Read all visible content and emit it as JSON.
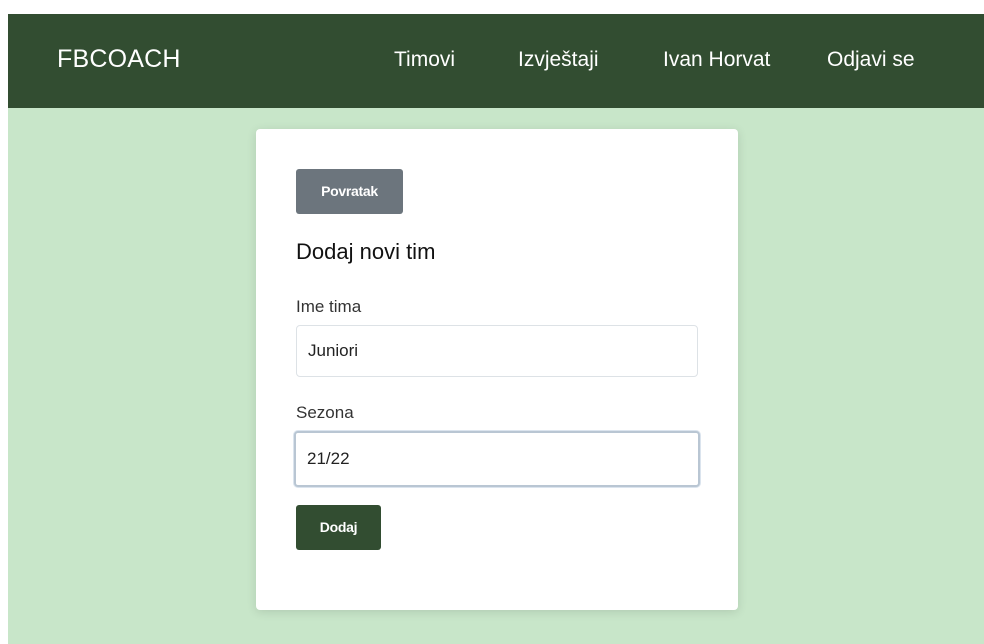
{
  "navbar": {
    "brand": "FBCOACH",
    "links": {
      "teams": "Timovi",
      "reports": "Izvještaji",
      "user": "Ivan Horvat",
      "logout": "Odjavi se"
    }
  },
  "form": {
    "back_label": "Povratak",
    "title": "Dodaj novi tim",
    "team_name_label": "Ime tima",
    "team_name_value": "Juniori",
    "season_label": "Sezona",
    "season_value": "21/22",
    "submit_label": "Dodaj"
  },
  "colors": {
    "navbar_bg": "#324d31",
    "page_bg": "#c8e6c9",
    "back_button": "#6c757d",
    "submit_button": "#324d31"
  }
}
